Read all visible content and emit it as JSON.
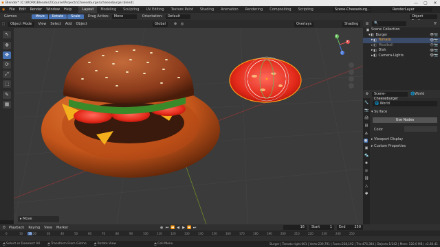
{
  "window": {
    "title": "Blender* [C:\\WORK\\Blender2\\Course\\Projects\\Cheeseburger\\cheeseburger.blend]",
    "controls": [
      "—",
      "▢",
      "✕"
    ]
  },
  "menu": {
    "items": [
      "File",
      "Edit",
      "Render",
      "Window",
      "Help"
    ]
  },
  "workspaces": {
    "tabs": [
      "Layout",
      "Modeling",
      "Sculpting",
      "UV Editing",
      "Texture Paint",
      "Shading",
      "Animation",
      "Rendering",
      "Compositing",
      "Scripting"
    ],
    "active": "Layout"
  },
  "scene_selector": {
    "value": "Scene-Cheeseburg..."
  },
  "renderlayer": {
    "value": "RenderLayer"
  },
  "toolheader": {
    "gizmo_label": "Gizmos",
    "modes": [
      "Move",
      "Rotate",
      "Scale"
    ],
    "drag_label": "Drag Action:",
    "drag_value": "Move",
    "orientation_label": "Orientation:",
    "orientation_value": "Default",
    "object_scatter": "Object Scatter"
  },
  "viewport_header": {
    "mode": "Object Mode",
    "menus": [
      "View",
      "Select",
      "Add",
      "Object"
    ],
    "transform": "Global",
    "overlays": "Overlays",
    "shading": "Shading"
  },
  "tools": [
    "↖",
    "✥",
    "⟳",
    "⤢",
    "⬚",
    "✎",
    "📏",
    "▦"
  ],
  "viewport": {
    "gizmo_axes": [
      "X",
      "Y",
      "Z"
    ],
    "operator_panel": "Move"
  },
  "outliner": {
    "header": "Scene Collection",
    "items": [
      {
        "label": "Burger",
        "icon": "▾",
        "selected": false
      },
      {
        "label": "Tomato",
        "icon": "▸",
        "selected": true
      },
      {
        "label": "Meatball",
        "icon": "▸",
        "selected": false
      },
      {
        "label": "Dish",
        "icon": "▸",
        "selected": false
      },
      {
        "label": "Camera-Lights",
        "icon": "▸",
        "selected": false
      }
    ]
  },
  "properties": {
    "scene_field": "Scene-Cheeseburger",
    "world_tab": "World",
    "world_field": "World",
    "surface_label": "Surface",
    "use_nodes": "Use Nodes",
    "color_label": "Color",
    "viewport_display": "Viewport Display",
    "custom_properties": "Custom Properties"
  },
  "timeline": {
    "menus": [
      "Playback",
      "Keying",
      "View",
      "Marker"
    ],
    "current_frame": "16",
    "start_label": "Start",
    "start": "1",
    "end_label": "End",
    "end": "250",
    "ruler": [
      "0",
      "10",
      "16",
      "20",
      "30",
      "40",
      "50",
      "60",
      "70",
      "80",
      "90",
      "100",
      "110",
      "120",
      "130",
      "140",
      "150",
      "160",
      "170",
      "180",
      "190",
      "200",
      "210",
      "220",
      "230",
      "240",
      "250"
    ],
    "transport": [
      "⏮",
      "⏪",
      "◀",
      "▶",
      "⏩",
      "⏭"
    ]
  },
  "statusbar": {
    "left": [
      "Select or Deselect All",
      "Transform From Gizmo",
      "Rotate View",
      "Cell Menu"
    ],
    "right": "Burger | Tomato-right.001 | Verts:239,791 | Faces:238,192 | Tris:476,384 | Objects:1/242 | Mem: 120.0 MB | v2.80.41"
  },
  "colors": {
    "accent": "#4772b3",
    "selected": "#ff9f1a"
  }
}
